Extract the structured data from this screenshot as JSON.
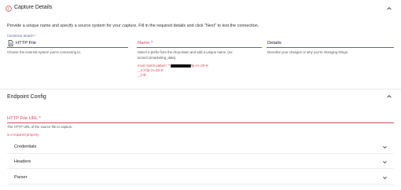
{
  "capture_details": {
    "title": "Capture Details",
    "intro": "Provide a unique name and specify a source system for your capture. Fill in the required details and click \"Next\" to test the connection."
  },
  "connector": {
    "search_label": "Connector Search *",
    "value": "HTTP File",
    "help": "Choose the external system you're connecting to."
  },
  "name_field": {
    "label": "Name *",
    "help_line1": "Select a prefix from the drop-down and add a unique name. (ex:",
    "help_line2": "acmeCo/marketing_data)",
    "error_prefix": "must match pattern \"^",
    "error_rest": "/[a-zA-Z0-9-",
    "error_line2": "_.]+)*/[a-zA-Z0-9-",
    "error_line3": "_.]+$\""
  },
  "details_field": {
    "label": "Details",
    "help": "Describe your changes or why you're changing things."
  },
  "endpoint_config": {
    "title": "Endpoint Config"
  },
  "url_field": {
    "label": "HTTP File URL *",
    "help": "The HTTP URL of the source file to capture.",
    "error": "is a required property"
  },
  "accordions": [
    {
      "label": "Credentials"
    },
    {
      "label": "Headers"
    },
    {
      "label": "Parser"
    }
  ],
  "colors": {
    "error": "#d94a55",
    "accent": "#5b5bd6"
  }
}
